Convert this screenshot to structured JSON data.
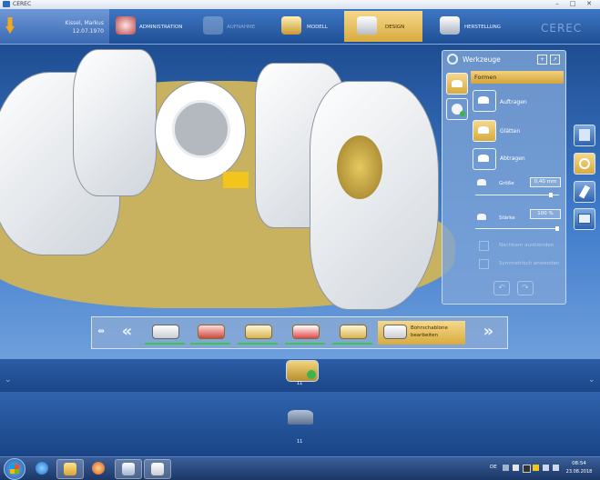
{
  "window": {
    "title": "CEREC",
    "minimize": "–",
    "maximize": "□",
    "close": "✕"
  },
  "patient": {
    "name": "Kissel, Markus",
    "dob": "12.07.1970"
  },
  "workflow": {
    "steps": [
      {
        "label": "ADMINISTRATION",
        "state": "done"
      },
      {
        "label": "AUFNAHME",
        "state": "disabled"
      },
      {
        "label": "MODELL",
        "state": "done"
      },
      {
        "label": "DESIGN",
        "state": "active"
      },
      {
        "label": "HERSTELLUNG",
        "state": "pending"
      }
    ],
    "brand": "CEREC"
  },
  "tools_panel": {
    "title": "Werkzeuge",
    "pin": "+",
    "expand": "↗",
    "category": "Formen",
    "tools": [
      {
        "label": "Auftragen",
        "active": false
      },
      {
        "label": "Glätten",
        "active": true
      },
      {
        "label": "Abtragen",
        "active": false
      }
    ],
    "size": {
      "label": "Größe",
      "value": "0,40 mm",
      "level_fraction": 0.92
    },
    "strength": {
      "label": "Stärke",
      "value": "100 %",
      "level_fraction": 1.0
    },
    "options": [
      {
        "label": "Nachbarn ausblenden",
        "enabled": false
      },
      {
        "label": "Symmetrisch anwenden",
        "enabled": false
      }
    ],
    "undo": "↶",
    "redo": "↷"
  },
  "toolbar": {
    "prev": "«",
    "next": "»",
    "lead_icon": "⇹",
    "items": [
      {
        "icon": "axis-tool-icon"
      },
      {
        "icon": "margin-tool-icon"
      },
      {
        "icon": "arch-tool-icon"
      },
      {
        "icon": "restoration-tool-icon"
      },
      {
        "icon": "crown-tool-icon"
      },
      {
        "icon": "bohrschablone-icon",
        "label": "Bohrschablone bearbeiten",
        "active": true
      }
    ]
  },
  "model_strip": {
    "label": "11"
  },
  "preparation": {
    "label": "11"
  },
  "taskbar": {
    "lang": "DE",
    "time": "08:54",
    "date": "23.08.2018"
  },
  "colors": {
    "accent": "#d8ab3e",
    "background": "#1f4f95",
    "gingiva": "#c9b25f"
  }
}
